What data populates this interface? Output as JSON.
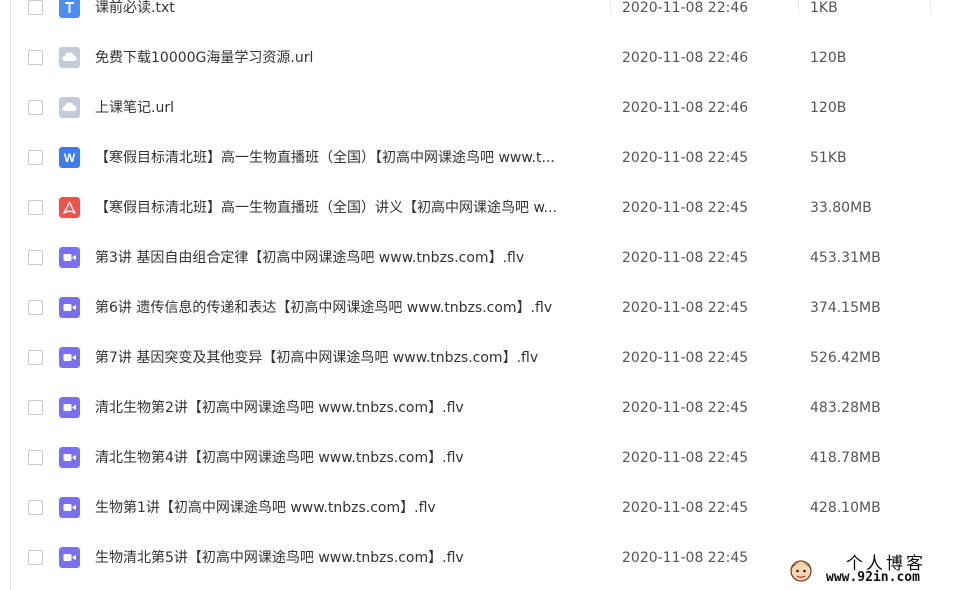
{
  "files": [
    {
      "name": "课前必读.txt",
      "date": "2020-11-08 22:46",
      "size": "1KB",
      "icon": "txt-file-icon",
      "icon_color": "#4e8cf5"
    },
    {
      "name": "免费下载10000G海量学习资源.url",
      "date": "2020-11-08 22:46",
      "size": "120B",
      "icon": "url-file-icon",
      "icon_color": "#c3cbd6"
    },
    {
      "name": "上课笔记.url",
      "date": "2020-11-08 22:46",
      "size": "120B",
      "icon": "url-file-icon",
      "icon_color": "#c3cbd6"
    },
    {
      "name": "【寒假目标清北班】高一生物直播班（全国）【初高中网课途鸟吧 www.t...",
      "date": "2020-11-08 22:45",
      "size": "51KB",
      "icon": "word-file-icon",
      "icon_color": "#3d7cf0"
    },
    {
      "name": "【寒假目标清北班】高一生物直播班（全国）讲义【初高中网课途鸟吧 w...",
      "date": "2020-11-08 22:45",
      "size": "33.80MB",
      "icon": "pdf-file-icon",
      "icon_color": "#f0514a"
    },
    {
      "name": "第3讲 基因自由组合定律【初高中网课途鸟吧 www.tnbzs.com】.flv",
      "date": "2020-11-08 22:45",
      "size": "453.31MB",
      "icon": "video-file-icon",
      "icon_color": "#7a6ff0"
    },
    {
      "name": "第6讲 遗传信息的传递和表达【初高中网课途鸟吧 www.tnbzs.com】.flv",
      "date": "2020-11-08 22:45",
      "size": "374.15MB",
      "icon": "video-file-icon",
      "icon_color": "#7a6ff0"
    },
    {
      "name": "第7讲 基因突变及其他变异【初高中网课途鸟吧 www.tnbzs.com】.flv",
      "date": "2020-11-08 22:45",
      "size": "526.42MB",
      "icon": "video-file-icon",
      "icon_color": "#7a6ff0"
    },
    {
      "name": "清北生物第2讲【初高中网课途鸟吧 www.tnbzs.com】.flv",
      "date": "2020-11-08 22:45",
      "size": "483.28MB",
      "icon": "video-file-icon",
      "icon_color": "#7a6ff0"
    },
    {
      "name": "清北生物第4讲【初高中网课途鸟吧 www.tnbzs.com】.flv",
      "date": "2020-11-08 22:45",
      "size": "418.78MB",
      "icon": "video-file-icon",
      "icon_color": "#7a6ff0"
    },
    {
      "name": "生物第1讲【初高中网课途鸟吧 www.tnbzs.com】.flv",
      "date": "2020-11-08 22:45",
      "size": "428.10MB",
      "icon": "video-file-icon",
      "icon_color": "#7a6ff0"
    },
    {
      "name": "生物清北第5讲【初高中网课途鸟吧 www.tnbzs.com】.flv",
      "date": "2020-11-08 22:45",
      "size": "",
      "icon": "video-file-icon",
      "icon_color": "#7a6ff0"
    }
  ],
  "watermark": {
    "title": "个人博客",
    "url": "www.92in.com"
  }
}
